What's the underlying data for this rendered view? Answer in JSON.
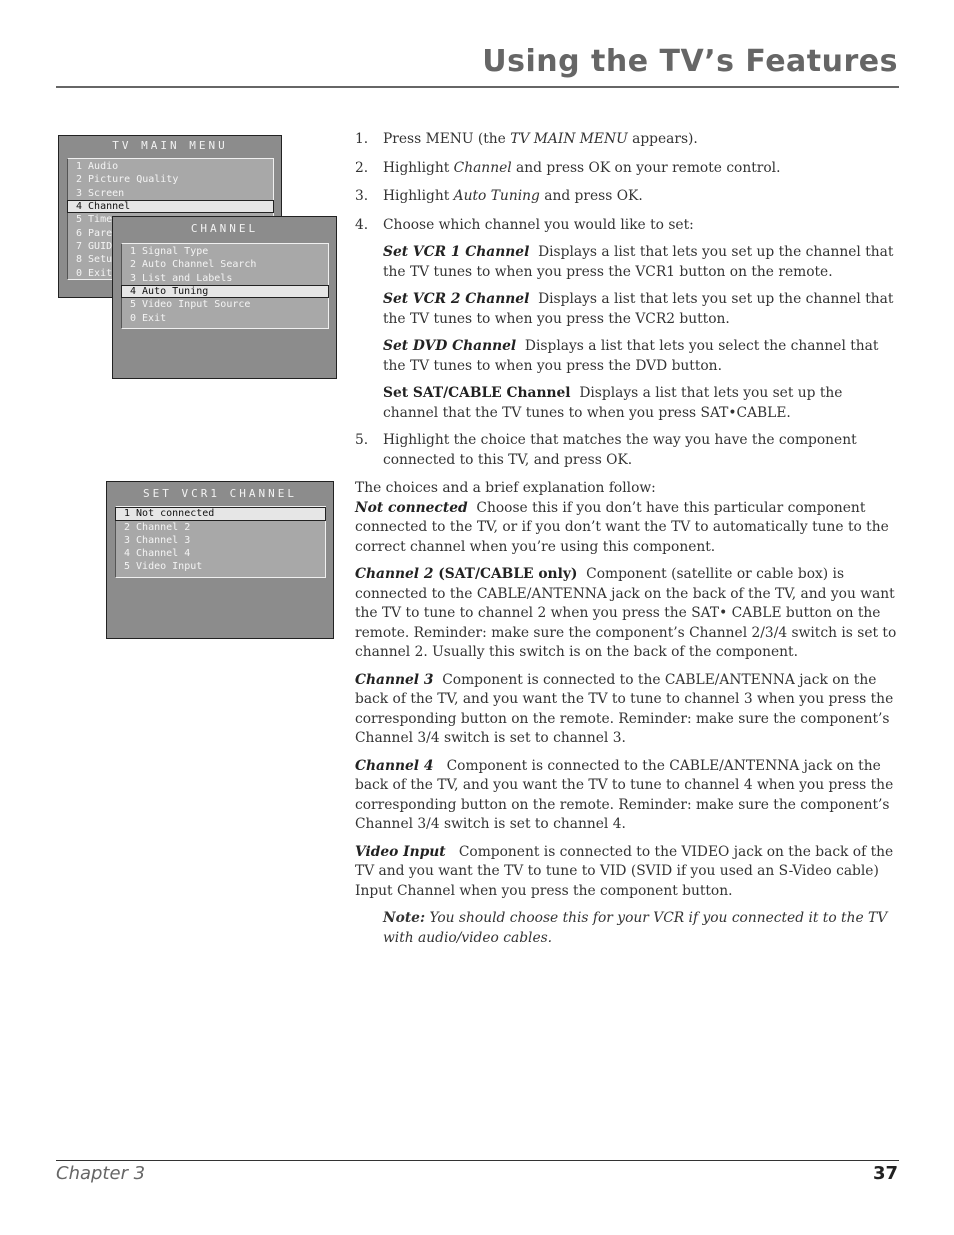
{
  "header": {
    "title": "Using the TV’s Features"
  },
  "osd": {
    "main_menu": {
      "title": "TV MAIN MENU",
      "items": [
        "1 Audio",
        "2 Picture Quality",
        "3 Screen",
        "4 Channel",
        "5 Time",
        "6 Pare",
        "7 GUID",
        "8 Setu",
        "0 Exit"
      ],
      "selected_index": 3
    },
    "channel_menu": {
      "title": "CHANNEL",
      "items": [
        "1 Signal Type",
        "2 Auto Channel Search",
        "3 List and Labels",
        "4 Auto Tuning",
        "5 Video Input Source",
        "0 Exit"
      ],
      "selected_index": 3
    },
    "vcr1_menu": {
      "title": "SET VCR1 CHANNEL",
      "items": [
        "1 Not connected",
        "2 Channel 2",
        "3 Channel 3",
        "4 Channel 4",
        "5 Video Input"
      ],
      "selected_index": 0
    }
  },
  "steps": {
    "s1": {
      "num": "1.",
      "pre": "Press MENU (the ",
      "em": "TV MAIN MENU",
      "post": " appears)."
    },
    "s2": {
      "num": "2.",
      "pre": "Highlight ",
      "em": "Channel",
      "post": " and press OK on your remote control."
    },
    "s3": {
      "num": "3.",
      "pre": "Highlight ",
      "em": "Auto Tuning",
      "post": " and press OK."
    },
    "s4": {
      "num": "4.",
      "text": "Choose which channel you would like to set:"
    },
    "s5": {
      "num": "5.",
      "text": "Highlight the choice that matches the way you have the component connected to this TV, and press OK."
    }
  },
  "step4_options": [
    {
      "term": "Set VCR 1 Channel",
      "text": "  Displays a list that lets you set up the channel that the TV tunes to when you press the VCR1 button on the remote."
    },
    {
      "term": "Set VCR 2 Channel",
      "text": "  Displays a list that lets you set up the channel that the TV tunes to when you press the VCR2 button."
    },
    {
      "term": "Set DVD Channel",
      "text": "  Displays a list that lets you select the channel that the TV tunes to when you press the DVD button."
    },
    {
      "term": "Set SAT/CABLE Channel",
      "text": "  Displays a list that lets you set up the channel that the TV tunes to when you press SAT•CABLE."
    }
  ],
  "choices": {
    "intro": "The choices and a brief explanation follow:",
    "items": [
      {
        "term": "Not connected",
        "extra": "",
        "text": "  Choose this if you don’t have this particular component connected to the TV, or if you don’t want the TV to automatically tune to the correct channel when you’re using this component."
      },
      {
        "term": "Channel 2",
        "extra": " (SAT/CABLE only)",
        "text": "  Component (satellite or cable box) is connected to the CABLE/ANTENNA jack on the back of the TV, and you want the TV to tune to channel 2 when you press the SAT• CABLE button on the remote. Reminder: make sure the component’s Channel 2/3/4 switch is set to channel 2. Usually this switch is on the back of the component."
      },
      {
        "term": "Channel 3",
        "extra": "",
        "text": "  Component is connected to the CABLE/ANTENNA jack on the back of the TV, and you want the TV to tune to channel 3 when you press the corresponding button on the remote. Reminder: make sure the component’s Channel 3/4 switch is set to channel 3."
      },
      {
        "term": "Channel 4",
        "extra": "",
        "text": "   Component is connected to the CABLE/ANTENNA jack on the back of the TV, and you want the TV to tune to channel 4 when you press the corresponding button on the remote. Reminder: make sure the component’s Channel 3/4 switch is set to channel 4."
      },
      {
        "term": "Video Input",
        "extra": "",
        "text": "   Component is connected to the VIDEO jack on the back of the TV and you want the TV to tune to VID (SVID if you used an S-Video cable) Input Channel when you press the component button."
      }
    ],
    "note_label": "Note:",
    "note_text": " You should choose this for your VCR if you connected it to the TV with audio/video cables."
  },
  "footer": {
    "chapter": "Chapter 3",
    "page": "37"
  }
}
